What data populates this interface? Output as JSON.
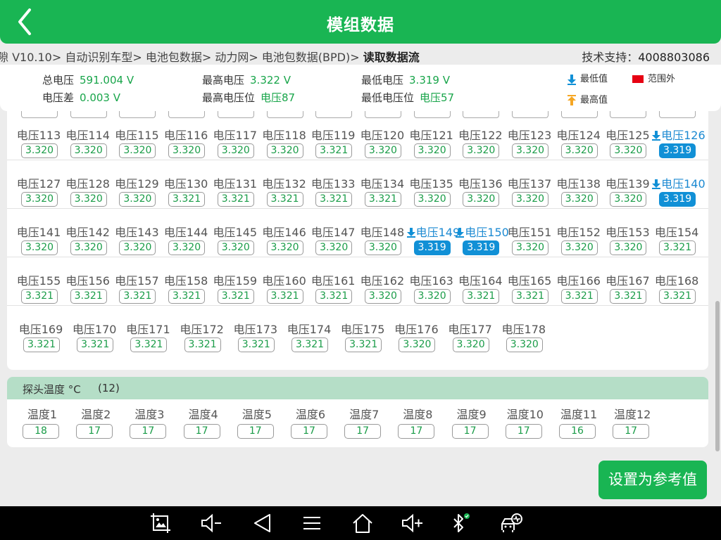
{
  "header": {
    "title": "模组数据"
  },
  "breadcrumb": {
    "path": "隙 V10.10> 自动识别车型> 电池包数据> 动力网> 电池包数据(BPD)> ",
    "current": "读取数据流"
  },
  "support": {
    "label": "技术支持：",
    "phone": "4008803086"
  },
  "summary": {
    "total_voltage": {
      "label": "总电压",
      "value": "591.004 V"
    },
    "max_voltage": {
      "label": "最高电压",
      "value": "3.322 V"
    },
    "min_voltage": {
      "label": "最低电压",
      "value": "3.319 V"
    },
    "voltage_diff": {
      "label": "电压差",
      "value": "0.003 V"
    },
    "max_voltage_pos": {
      "label": "最高电压位",
      "value": "电压87"
    },
    "min_voltage_pos": {
      "label": "最低电压位",
      "value": "电压57"
    }
  },
  "legend": {
    "min": "最低值",
    "out_of_range": "范围外",
    "max": "最高值",
    "min_color": "#1190d6",
    "out_color": "#e60012",
    "max_color": "#f5a623"
  },
  "cells": [
    {
      "name": "电压113",
      "value": "3.320",
      "low": false
    },
    {
      "name": "电压114",
      "value": "3.320",
      "low": false
    },
    {
      "name": "电压115",
      "value": "3.320",
      "low": false
    },
    {
      "name": "电压116",
      "value": "3.320",
      "low": false
    },
    {
      "name": "电压117",
      "value": "3.320",
      "low": false
    },
    {
      "name": "电压118",
      "value": "3.320",
      "low": false
    },
    {
      "name": "电压119",
      "value": "3.321",
      "low": false
    },
    {
      "name": "电压120",
      "value": "3.320",
      "low": false
    },
    {
      "name": "电压121",
      "value": "3.320",
      "low": false
    },
    {
      "name": "电压122",
      "value": "3.320",
      "low": false
    },
    {
      "name": "电压123",
      "value": "3.320",
      "low": false
    },
    {
      "name": "电压124",
      "value": "3.320",
      "low": false
    },
    {
      "name": "电压125",
      "value": "3.320",
      "low": false
    },
    {
      "name": "电压126",
      "value": "3.319",
      "low": true
    },
    {
      "name": "电压127",
      "value": "3.320",
      "low": false
    },
    {
      "name": "电压128",
      "value": "3.320",
      "low": false
    },
    {
      "name": "电压129",
      "value": "3.320",
      "low": false
    },
    {
      "name": "电压130",
      "value": "3.321",
      "low": false
    },
    {
      "name": "电压131",
      "value": "3.321",
      "low": false
    },
    {
      "name": "电压132",
      "value": "3.321",
      "low": false
    },
    {
      "name": "电压133",
      "value": "3.321",
      "low": false
    },
    {
      "name": "电压134",
      "value": "3.321",
      "low": false
    },
    {
      "name": "电压135",
      "value": "3.320",
      "low": false
    },
    {
      "name": "电压136",
      "value": "3.320",
      "low": false
    },
    {
      "name": "电压137",
      "value": "3.320",
      "low": false
    },
    {
      "name": "电压138",
      "value": "3.320",
      "low": false
    },
    {
      "name": "电压139",
      "value": "3.320",
      "low": false
    },
    {
      "name": "电压140",
      "value": "3.319",
      "low": true
    },
    {
      "name": "电压141",
      "value": "3.320",
      "low": false
    },
    {
      "name": "电压142",
      "value": "3.320",
      "low": false
    },
    {
      "name": "电压143",
      "value": "3.320",
      "low": false
    },
    {
      "name": "电压144",
      "value": "3.320",
      "low": false
    },
    {
      "name": "电压145",
      "value": "3.320",
      "low": false
    },
    {
      "name": "电压146",
      "value": "3.320",
      "low": false
    },
    {
      "name": "电压147",
      "value": "3.320",
      "low": false
    },
    {
      "name": "电压148",
      "value": "3.320",
      "low": false
    },
    {
      "name": "电压149",
      "value": "3.319",
      "low": true
    },
    {
      "name": "电压150",
      "value": "3.319",
      "low": true
    },
    {
      "name": "电压151",
      "value": "3.320",
      "low": false
    },
    {
      "name": "电压152",
      "value": "3.320",
      "low": false
    },
    {
      "name": "电压153",
      "value": "3.320",
      "low": false
    },
    {
      "name": "电压154",
      "value": "3.321",
      "low": false
    },
    {
      "name": "电压155",
      "value": "3.321",
      "low": false
    },
    {
      "name": "电压156",
      "value": "3.321",
      "low": false
    },
    {
      "name": "电压157",
      "value": "3.321",
      "low": false
    },
    {
      "name": "电压158",
      "value": "3.321",
      "low": false
    },
    {
      "name": "电压159",
      "value": "3.321",
      "low": false
    },
    {
      "name": "电压160",
      "value": "3.321",
      "low": false
    },
    {
      "name": "电压161",
      "value": "3.321",
      "low": false
    },
    {
      "name": "电压162",
      "value": "3.320",
      "low": false
    },
    {
      "name": "电压163",
      "value": "3.320",
      "low": false
    },
    {
      "name": "电压164",
      "value": "3.321",
      "low": false
    },
    {
      "name": "电压165",
      "value": "3.321",
      "low": false
    },
    {
      "name": "电压166",
      "value": "3.321",
      "low": false
    },
    {
      "name": "电压167",
      "value": "3.321",
      "low": false
    },
    {
      "name": "电压168",
      "value": "3.321",
      "low": false
    },
    {
      "name": "电压169",
      "value": "3.321",
      "low": false
    },
    {
      "name": "电压170",
      "value": "3.321",
      "low": false
    },
    {
      "name": "电压171",
      "value": "3.321",
      "low": false
    },
    {
      "name": "电压172",
      "value": "3.321",
      "low": false
    },
    {
      "name": "电压173",
      "value": "3.321",
      "low": false
    },
    {
      "name": "电压174",
      "value": "3.321",
      "low": false
    },
    {
      "name": "电压175",
      "value": "3.321",
      "low": false
    },
    {
      "name": "电压176",
      "value": "3.320",
      "low": false
    },
    {
      "name": "电压177",
      "value": "3.320",
      "low": false
    },
    {
      "name": "电压178",
      "value": "3.320",
      "low": false
    }
  ],
  "temperature": {
    "title": "探头温度 °C",
    "count": "(12)",
    "probes": [
      {
        "name": "温度1",
        "value": "18"
      },
      {
        "name": "温度2",
        "value": "17"
      },
      {
        "name": "温度3",
        "value": "17"
      },
      {
        "name": "温度4",
        "value": "17"
      },
      {
        "name": "温度5",
        "value": "17"
      },
      {
        "name": "温度6",
        "value": "17"
      },
      {
        "name": "温度7",
        "value": "17"
      },
      {
        "name": "温度8",
        "value": "17"
      },
      {
        "name": "温度9",
        "value": "17"
      },
      {
        "name": "温度10",
        "value": "17"
      },
      {
        "name": "温度11",
        "value": "16"
      },
      {
        "name": "温度12",
        "value": "17"
      }
    ]
  },
  "actions": {
    "set_reference": "设置为参考值"
  },
  "navbar": [
    "screenshot-icon",
    "volume-down-icon",
    "back-icon",
    "menu-icon",
    "home-icon",
    "volume-up-icon",
    "bluetooth-icon",
    "car-diagnostic-icon"
  ]
}
